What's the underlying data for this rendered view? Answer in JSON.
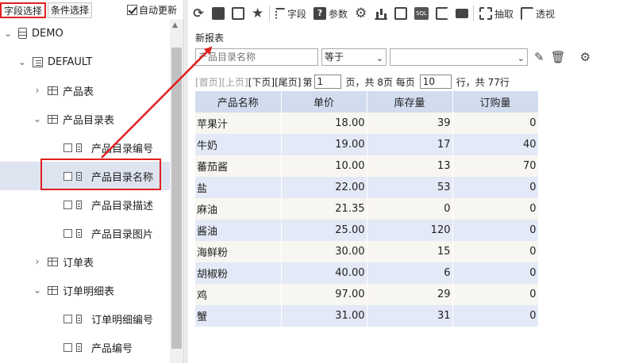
{
  "left_tabs": {
    "field_select": "字段选择",
    "condition_select": "条件选择",
    "auto_update": "自动更新"
  },
  "tree": {
    "nodes": [
      {
        "label": "DEMO",
        "icon": "database-icon",
        "expand": "expanded"
      },
      {
        "label": "DEFAULT",
        "icon": "schema-icon",
        "expand": "expanded"
      },
      {
        "label": "产品表",
        "icon": "table-icon",
        "expand": "collapsed"
      },
      {
        "label": "产品目录表",
        "icon": "table-icon",
        "expand": "expanded"
      },
      {
        "label": "产品目录编号",
        "icon": "field-icon",
        "expand": "leaf"
      },
      {
        "label": "产品目录名称",
        "icon": "field-icon",
        "expand": "leaf",
        "selected": true
      },
      {
        "label": "产品目录描述",
        "icon": "field-icon",
        "expand": "leaf"
      },
      {
        "label": "产品目录图片",
        "icon": "field-icon",
        "expand": "leaf"
      },
      {
        "label": "订单表",
        "icon": "table-icon",
        "expand": "collapsed"
      },
      {
        "label": "订单明细表",
        "icon": "table-icon",
        "expand": "expanded"
      },
      {
        "label": "订单明细编号",
        "icon": "field-icon",
        "expand": "leaf"
      },
      {
        "label": "产品编号",
        "icon": "field-icon",
        "expand": "leaf"
      }
    ]
  },
  "toolbar": {
    "icons": [
      "refresh-icon",
      "save-icon",
      "save-as-icon",
      "favorite-star-icon"
    ],
    "fields_label": "字段",
    "params_label": "参数",
    "sql_label": "SQL",
    "extract_label": "抽取",
    "pivot_label": "透视"
  },
  "report": {
    "title": "新报表"
  },
  "filter": {
    "field_placeholder": "产品目录名称",
    "operator": "等于",
    "value": ""
  },
  "pager": {
    "first": "[首页]",
    "prev": "[上页]",
    "next": "[下页]",
    "last": "[尾页]",
    "page_prefix": "第",
    "current_page": "1",
    "page_suffix": "页，共 8页 每页",
    "page_size": "10",
    "row_suffix": "行，共 77行"
  },
  "table": {
    "columns": [
      "产品名称",
      "单价",
      "库存量",
      "订购量"
    ],
    "rows": [
      [
        "苹果汁",
        "18.00",
        "39",
        "0"
      ],
      [
        "牛奶",
        "19.00",
        "17",
        "40"
      ],
      [
        "蕃茄酱",
        "10.00",
        "13",
        "70"
      ],
      [
        "盐",
        "22.00",
        "53",
        "0"
      ],
      [
        "麻油",
        "21.35",
        "0",
        "0"
      ],
      [
        "酱油",
        "25.00",
        "120",
        "0"
      ],
      [
        "海鲜粉",
        "30.00",
        "15",
        "0"
      ],
      [
        "胡椒粉",
        "40.00",
        "6",
        "0"
      ],
      [
        "鸡",
        "97.00",
        "29",
        "0"
      ],
      [
        "蟹",
        "31.00",
        "31",
        "0"
      ]
    ]
  },
  "colors": {
    "highlight_red": "#e02020",
    "header_blue": "#d2dcef",
    "row_even": "#e4e9f7",
    "row_odd": "#f8f6f0"
  }
}
